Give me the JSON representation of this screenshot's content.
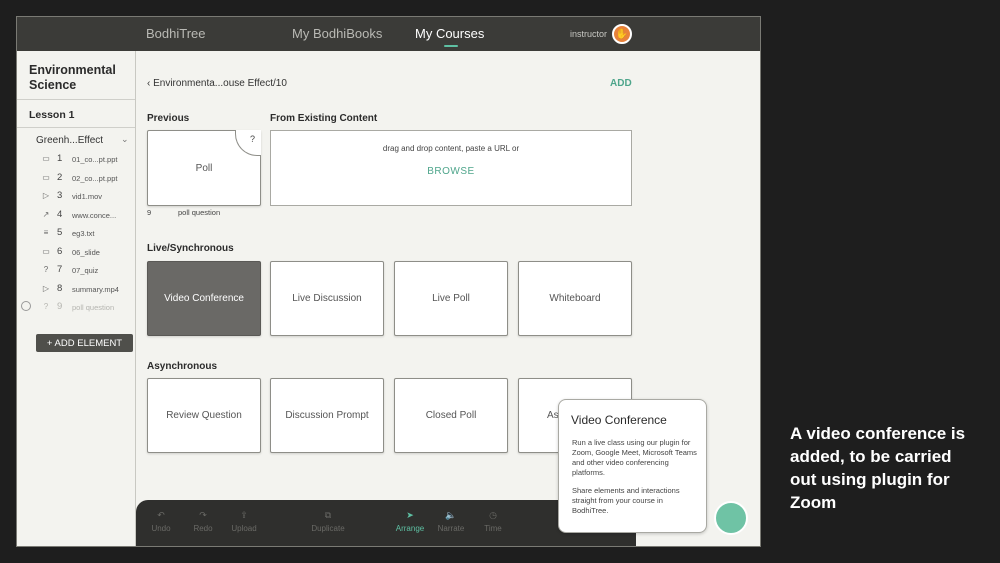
{
  "topbar": {
    "brand": "BodhiTree",
    "nav": [
      "My BodhiBooks",
      "My Courses"
    ],
    "role": "instructor",
    "avatar_glyph": "✋"
  },
  "sidebar": {
    "course_title": "Environmental Science",
    "lesson": "Lesson 1",
    "module": "Greenh...Effect",
    "module_chevron": "⌄",
    "items": [
      {
        "num": "1",
        "name": "01_co...pt.ppt",
        "icon": "▭"
      },
      {
        "num": "2",
        "name": "02_co...pt.ppt",
        "icon": "▭"
      },
      {
        "num": "3",
        "name": "vid1.mov",
        "icon": "▷"
      },
      {
        "num": "4",
        "name": "www.conce...",
        "icon": "↗"
      },
      {
        "num": "5",
        "name": "eg3.txt",
        "icon": "≡"
      },
      {
        "num": "6",
        "name": "06_slide",
        "icon": "▭"
      },
      {
        "num": "7",
        "name": "07_quiz",
        "icon": "?"
      },
      {
        "num": "8",
        "name": "summary.mp4",
        "icon": "▷"
      },
      {
        "num": "9",
        "name": "poll question",
        "icon": "?"
      }
    ],
    "add_element": "+ ADD ELEMENT"
  },
  "main": {
    "breadcrumb": "‹  Environmenta...ouse Effect/10",
    "add_label": "ADD",
    "previous_heading": "Previous",
    "previous_card": {
      "label": "Poll",
      "corner": "?",
      "number": "9",
      "caption": "poll question"
    },
    "existing_heading": "From Existing Content",
    "drop_text": "drag and drop content, paste a URL or",
    "browse_label": "BROWSE",
    "live_heading": "Live/Synchronous",
    "live_cards": [
      "Video Conference",
      "Live Discussion",
      "Live Poll",
      "Whiteboard"
    ],
    "async_heading": "Asynchronous",
    "async_cards": [
      "Review Question",
      "Discussion Prompt",
      "Closed Poll",
      "As"
    ]
  },
  "toolbar": {
    "tools": [
      {
        "label": "Undo",
        "icon": "↶"
      },
      {
        "label": "Redo",
        "icon": "↷"
      },
      {
        "label": "Upload",
        "icon": "⇪"
      },
      {
        "label": "Duplicate",
        "icon": "⧉"
      },
      {
        "label": "Arrange",
        "icon": "➤"
      },
      {
        "label": "Narrate",
        "icon": "🔈"
      },
      {
        "label": "Time",
        "icon": "◷"
      }
    ]
  },
  "popup": {
    "title": "Video Conference",
    "p1": "Run a live class using our plugin for Zoom, Google Meet, Microsoft Teams and other video conferencing platforms.",
    "p2": "Share elements and interactions straight from your course in BodhiTree."
  },
  "caption": "A video conference is added, to be carried out using plugin for Zoom",
  "colors": {
    "accent": "#5ec0a3",
    "topbar": "#3b3b38",
    "selected_card": "#6a6966"
  }
}
